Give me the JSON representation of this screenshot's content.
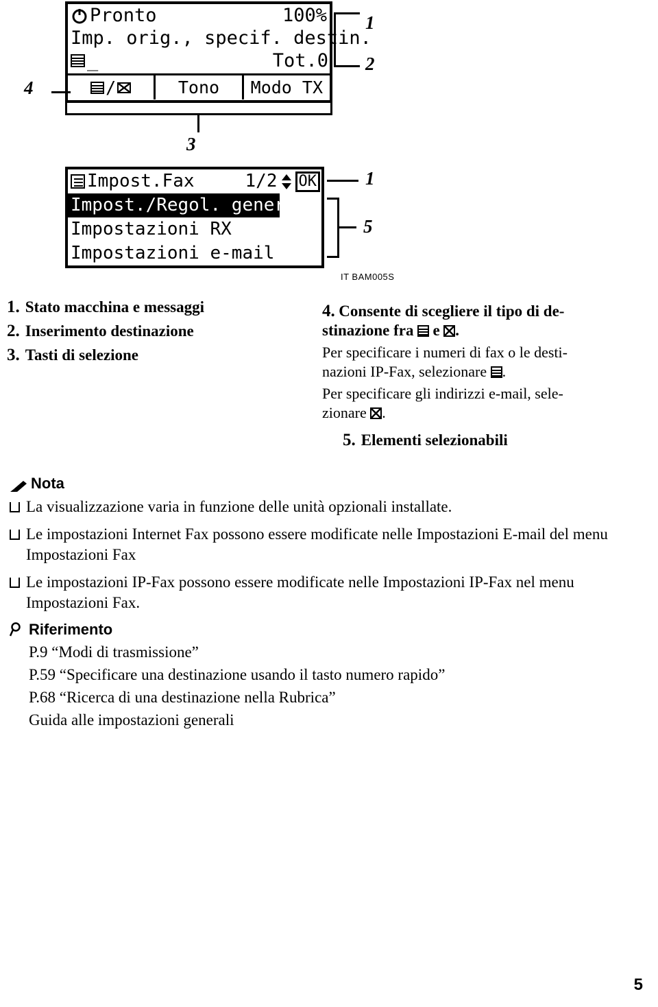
{
  "illustration": {
    "top_screen": {
      "status": "Pronto",
      "battery": "100%",
      "line2": "Imp. orig., specif. destin.",
      "line3_left": "_",
      "line3_right": "Tot.0",
      "softkeys": [
        "/",
        "Tono",
        "Modo TX"
      ]
    },
    "bottom_screen": {
      "title": "Impost.Fax",
      "page": "1/2",
      "ok": "OK",
      "items": [
        "Impost./Regol. gener.",
        "Impostazioni RX",
        "Impostazioni e-mail"
      ]
    },
    "callouts": [
      "1",
      "2",
      "4",
      "3",
      "1",
      "5"
    ],
    "code": "IT BAM005S"
  },
  "legend": {
    "left": [
      {
        "num": "1.",
        "label": "Stato macchina e messaggi"
      },
      {
        "num": "2.",
        "label": "Inserimento destinazione"
      },
      {
        "num": "3.",
        "label": "Tasti di selezione"
      }
    ],
    "right": {
      "num4": "4.",
      "title_a": "Consente di scegliere il tipo di de-",
      "title_b": "stinazione fra",
      "title_c": "e",
      "title_d": ".",
      "body_1a": "Per specificare i numeri di fax o le desti-",
      "body_1b": "nazioni IP-Fax, selezionare",
      "body_1c": ".",
      "body_2a": "Per specificare gli indirizzi e-mail, sele-",
      "body_2b": "zionare",
      "body_2c": ".",
      "num5": "5.",
      "label5": "Elementi selezionabili"
    }
  },
  "notes": {
    "heading": "Nota",
    "bullets": [
      "La visualizzazione varia in funzione delle unità opzionali installate.",
      "Le impostazioni Internet Fax possono essere modificate nelle Impostazioni E-mail del menu Impostazioni Fax",
      "Le impostazioni IP-Fax possono essere modificate nelle Impostazioni IP-Fax nel menu Impostazioni Fax."
    ]
  },
  "reference": {
    "heading": "Riferimento",
    "items": [
      "P.9 “Modi di trasmissione”",
      "P.59 “Specificare una destinazione usando il tasto numero rapido”",
      "P.68 “Ricerca di una destinazione nella Rubrica”",
      "Guida alle impostazioni generali"
    ]
  },
  "page_number": "5"
}
